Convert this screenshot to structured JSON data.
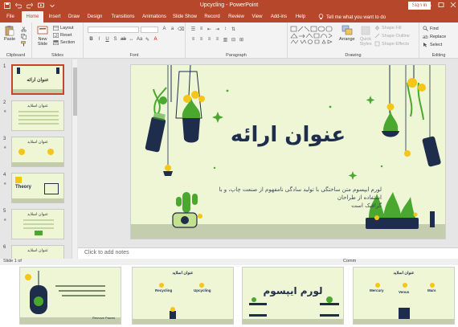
{
  "window": {
    "title": "Upcycling  -  PowerPoint",
    "signin_label": "Sign in"
  },
  "ribbon_tabs": [
    {
      "label": "File"
    },
    {
      "label": "Home"
    },
    {
      "label": "Insert"
    },
    {
      "label": "Draw"
    },
    {
      "label": "Design"
    },
    {
      "label": "Transitions"
    },
    {
      "label": "Animations"
    },
    {
      "label": "Slide Show"
    },
    {
      "label": "Record"
    },
    {
      "label": "Review"
    },
    {
      "label": "View"
    },
    {
      "label": "Add-ins"
    },
    {
      "label": "Help"
    }
  ],
  "active_tab": "Home",
  "tell_me_placeholder": "Tell me what you want to do",
  "ribbon": {
    "clipboard": {
      "label": "Clipboard",
      "paste": "Paste"
    },
    "slides": {
      "label": "Slides",
      "new_slide": "New Slide",
      "layout": "Layout",
      "reset": "Reset",
      "section": "Section"
    },
    "font": {
      "label": "Font"
    },
    "paragraph": {
      "label": "Paragraph"
    },
    "drawing": {
      "label": "Drawing",
      "arrange": "Arrange",
      "quick_styles": "Quick Styles",
      "shape_fill": "Shape Fill",
      "shape_outline": "Shape Outline",
      "shape_effects": "Shape Effects"
    },
    "editing": {
      "label": "Editing",
      "find": "Find",
      "replace": "Replace",
      "select": "Select"
    }
  },
  "thumbnails": [
    {
      "number": "1",
      "title": "عنوان ارائه"
    },
    {
      "number": "2",
      "title": "عنوان اسلاید"
    },
    {
      "number": "3",
      "title": "عنوان اسلاید"
    },
    {
      "number": "4",
      "title": "Theory"
    },
    {
      "number": "5",
      "title": "عنوان اسلاید"
    },
    {
      "number": "6",
      "title": "عنوان اسلاید"
    }
  ],
  "slide": {
    "title": "عنوان ارائه",
    "subtitle_line1": "لورم ایپسوم متن ساختگی با تولید سادگی نامفهوم از صنعت چاپ، و با استفاده از طراحان",
    "subtitle_line2": "گرافیک است"
  },
  "notes_placeholder": "Click to add notes",
  "status": {
    "slide_counter": "Slide 1 of",
    "comments": "Comm"
  },
  "sorter": [
    {
      "title": "",
      "caption": "Remove Pawns"
    },
    {
      "title": "عنوان اسلاید",
      "col1": "Recycling",
      "col2": "Upcycling"
    },
    {
      "title": "لورم ایپسوم"
    },
    {
      "title": "عنوان اسلاید",
      "col1": "Mercury",
      "col2": "Venus",
      "col3": "Mars"
    }
  ],
  "colors": {
    "accent": "#b7472a",
    "slide_bg": "#eef6d6",
    "plant_green": "#4aa82f",
    "pot_navy": "#1f2d4d",
    "flower_yellow": "#f5c518"
  }
}
